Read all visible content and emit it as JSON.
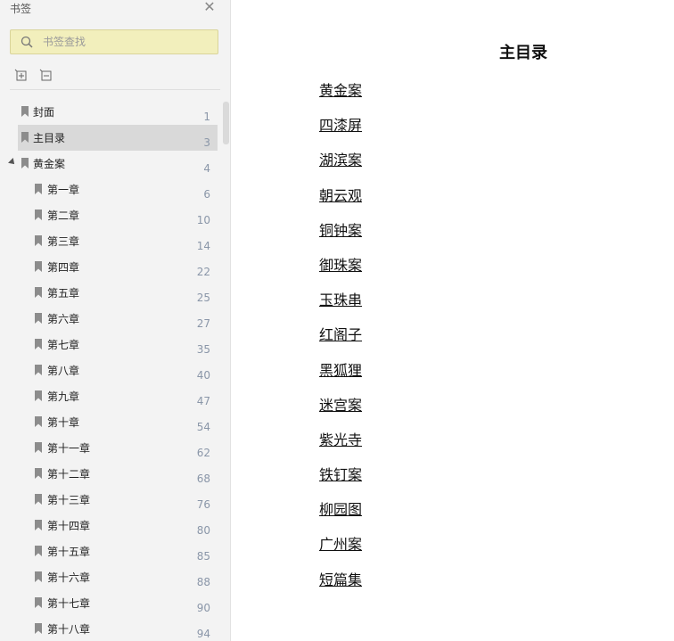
{
  "sidebar": {
    "title": "书签",
    "search_placeholder": "书签查找",
    "items": [
      {
        "label": "封面",
        "page": "1",
        "level": 1
      },
      {
        "label": "主目录",
        "page": "3",
        "level": 1,
        "selected": true
      },
      {
        "label": "黄金案",
        "page": "4",
        "level": 1,
        "expanded": true
      },
      {
        "label": "第一章",
        "page": "6",
        "level": 2
      },
      {
        "label": "第二章",
        "page": "10",
        "level": 2
      },
      {
        "label": "第三章",
        "page": "14",
        "level": 2
      },
      {
        "label": "第四章",
        "page": "22",
        "level": 2
      },
      {
        "label": "第五章",
        "page": "25",
        "level": 2
      },
      {
        "label": "第六章",
        "page": "27",
        "level": 2
      },
      {
        "label": "第七章",
        "page": "35",
        "level": 2
      },
      {
        "label": "第八章",
        "page": "40",
        "level": 2
      },
      {
        "label": "第九章",
        "page": "47",
        "level": 2
      },
      {
        "label": "第十章",
        "page": "54",
        "level": 2
      },
      {
        "label": "第十一章",
        "page": "62",
        "level": 2
      },
      {
        "label": "第十二章",
        "page": "68",
        "level": 2
      },
      {
        "label": "第十三章",
        "page": "76",
        "level": 2
      },
      {
        "label": "第十四章",
        "page": "80",
        "level": 2
      },
      {
        "label": "第十五章",
        "page": "85",
        "level": 2
      },
      {
        "label": "第十六章",
        "page": "88",
        "level": 2
      },
      {
        "label": "第十七章",
        "page": "90",
        "level": 2
      },
      {
        "label": "第十八章",
        "page": "94",
        "level": 2
      }
    ]
  },
  "document": {
    "title": "主目录",
    "toc": [
      "黄金案",
      "四漆屏",
      "湖滨案",
      "朝云观",
      "铜钟案",
      "御珠案",
      "玉珠串",
      "红阁子",
      "黑狐狸",
      "迷宫案",
      "紫光寺",
      "铁钉案",
      "柳园图",
      "广州案",
      "短篇集"
    ]
  },
  "icons": {
    "close": "close-icon",
    "search": "search-icon",
    "expand_all": "expand-all-icon",
    "collapse_all": "collapse-all-icon",
    "bookmark": "bookmark-icon"
  },
  "colors": {
    "search_bg": "#f2efbc",
    "selected_row": "#d9d9d9",
    "page_number": "#8a96a8"
  }
}
